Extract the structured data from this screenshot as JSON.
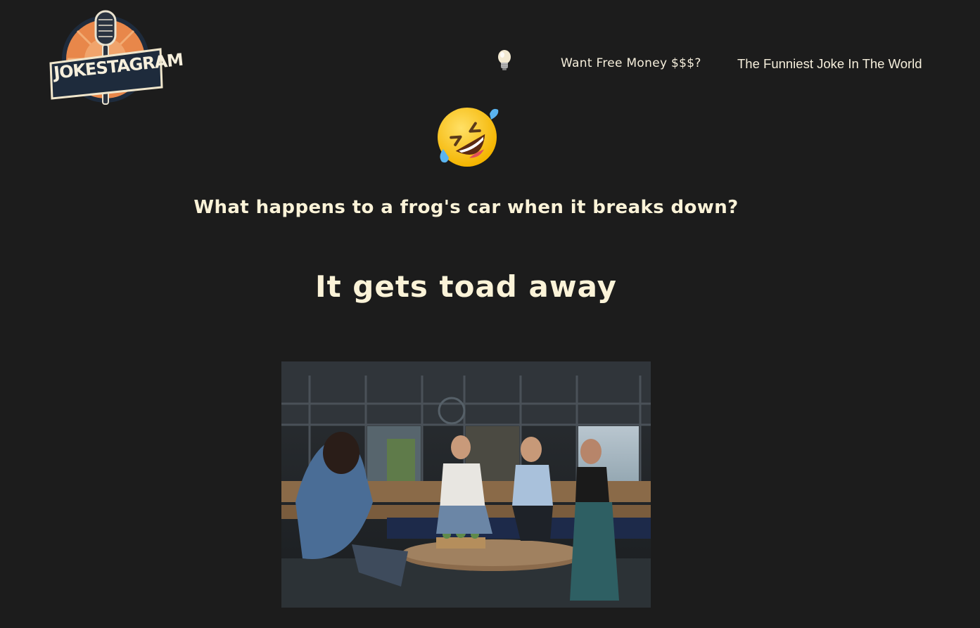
{
  "header": {
    "logo_text": "JOKESTAGRAM"
  },
  "nav": {
    "icon": "lightbulb-icon",
    "items": [
      {
        "label": "Want Free Money $$$?"
      },
      {
        "label": "The Funniest Joke In The World"
      }
    ]
  },
  "main": {
    "emoji": "rolling-on-floor-laughing-emoji",
    "question": "What happens to a frog's car when it breaks down?",
    "answer": "It gets toad away",
    "image": "friends-laughing-at-cafe-table"
  },
  "colors": {
    "background": "#1c1c1c",
    "text": "#fbf3d8",
    "logo_orange": "#e8874a",
    "logo_navy": "#1e2b3c"
  }
}
